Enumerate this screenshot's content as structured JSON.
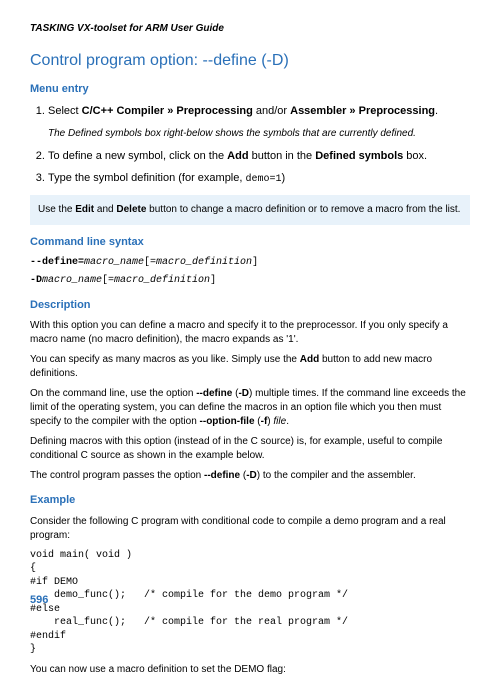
{
  "header": "TASKING VX-toolset for ARM User Guide",
  "title": "Control program option: --define (-D)",
  "sections": {
    "menu_entry": "Menu entry",
    "cmd_syntax": "Command line syntax",
    "description": "Description",
    "example": "Example"
  },
  "steps": {
    "s1a": "Select ",
    "s1b": "C/C++ Compiler » Preprocessing",
    "s1c": " and/or ",
    "s1d": "Assembler » Preprocessing",
    "s1e": ".",
    "note": "The Defined symbols box right-below shows the symbols that are currently defined.",
    "s2a": "To define a new symbol, click on the ",
    "s2b": "Add",
    "s2c": " button in the ",
    "s2d": "Defined symbols",
    "s2e": " box.",
    "s3a": "Type the symbol definition (for example, ",
    "s3b": "demo=1",
    "s3c": ")"
  },
  "infobox": {
    "a": "Use the ",
    "b": "Edit",
    "c": " and ",
    "d": "Delete",
    "e": " button to change a macro definition or to remove a macro from the list."
  },
  "syntax": {
    "l1a": "--define=",
    "l1b": "macro_name",
    "l1c": "[=",
    "l1d": "macro_definition",
    "l1e": "]",
    "l2a": "-D",
    "l2b": "macro_name",
    "l2c": "[=",
    "l2d": "macro_definition",
    "l2e": "]"
  },
  "desc": {
    "p1": "With this option you can define a macro and specify it to the preprocessor. If you only specify a macro name (no macro definition), the macro expands as '1'.",
    "p2a": "You can specify as many macros as you like. Simply use the ",
    "p2b": "Add",
    "p2c": " button to add new macro definitions.",
    "p3a": "On the command line, use the option ",
    "p3b": "--define",
    "p3c": " (",
    "p3d": "-D",
    "p3e": ") multiple times. If the command line exceeds the limit of the operating system, you can define the macros in an option file which you then must specify to the compiler with the option ",
    "p3f": "--option-file",
    "p3g": " (",
    "p3h": "-f",
    "p3i": ") ",
    "p3j": "file",
    "p3k": ".",
    "p4": "Defining macros with this option (instead of in the C source) is, for example, useful to compile conditional C source as shown in the example below.",
    "p5a": "The control program passes the option ",
    "p5b": "--define",
    "p5c": " (",
    "p5d": "-D",
    "p5e": ") to the compiler and the assembler."
  },
  "example": {
    "intro": "Consider the following C program with conditional code to compile a demo program and a real program:",
    "code": "void main( void )\n{\n#if DEMO\n    demo_func();   /* compile for the demo program */\n#else\n    real_func();   /* compile for the real program */\n#endif\n}",
    "outro": "You can now use a macro definition to set the DEMO flag:"
  },
  "page_num": "596"
}
